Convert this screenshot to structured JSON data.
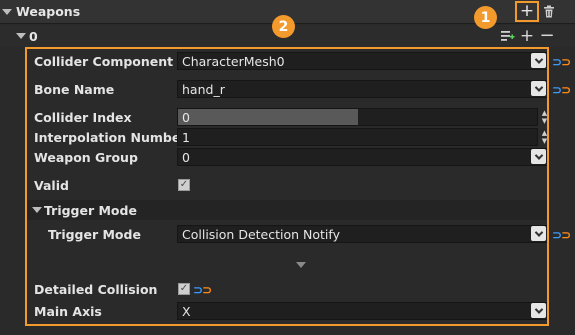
{
  "header": {
    "title": "Weapons",
    "add_icon": "plus-icon",
    "delete_icon": "trash-icon"
  },
  "item": {
    "index_label": "0",
    "icons": [
      "add-component-icon",
      "plus-icon",
      "minus-icon"
    ]
  },
  "annotations": {
    "badge1": "1",
    "badge2": "2",
    "accent_color": "#f39a2c"
  },
  "properties": {
    "collider_component": {
      "label": "Collider Component",
      "value": "CharacterMesh0"
    },
    "bone_name": {
      "label": "Bone Name",
      "value": "hand_r"
    },
    "collider_index": {
      "label": "Collider Index",
      "value": "0"
    },
    "interpolation_number": {
      "label": "Interpolation Number",
      "value": "1"
    },
    "weapon_group": {
      "label": "Weapon Group",
      "value": "0"
    },
    "valid": {
      "label": "Valid",
      "checked": true
    },
    "trigger_mode_section": {
      "label": "Trigger Mode"
    },
    "trigger_mode": {
      "label": "Trigger Mode",
      "value": "Collision Detection Notify"
    },
    "detailed_collision": {
      "label": "Detailed Collision",
      "checked": true
    },
    "main_axis": {
      "label": "Main Axis",
      "value": "X"
    }
  },
  "reset_icon_colors": {
    "blue": "#3b9bff",
    "orange": "#ff8c1a"
  }
}
